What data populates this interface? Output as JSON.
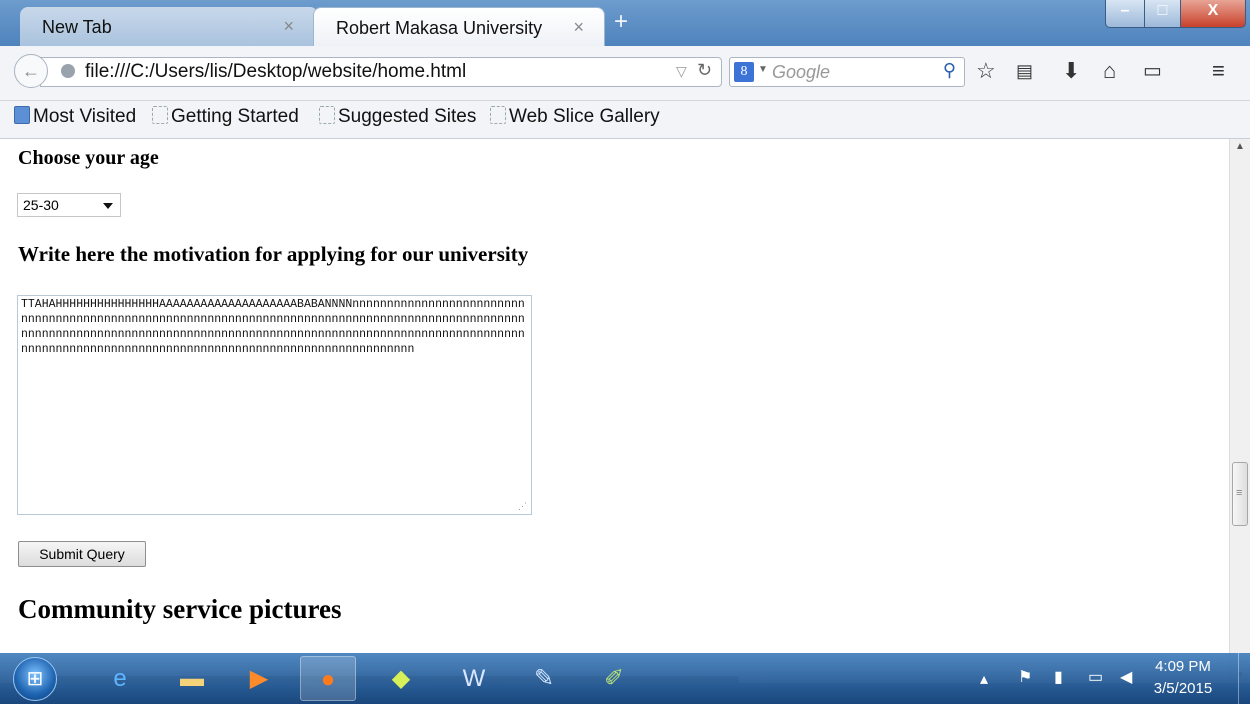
{
  "window": {
    "tabs": [
      {
        "label": "New Tab"
      },
      {
        "label": "Robert Makasa University"
      }
    ],
    "tab_close_glyph": "×",
    "new_tab_glyph": "+",
    "controls": {
      "minimize": "–",
      "maximize": "□",
      "close": "X"
    }
  },
  "navbar": {
    "url": "file:///C:/Users/lis/Desktop/website/home.html",
    "search_engine_badge": "8",
    "search_placeholder": "Google",
    "icons": [
      "back-icon",
      "globe-icon",
      "reload-icon",
      "search-icon",
      "bookmark-star-icon",
      "reading-list-icon",
      "download-icon",
      "home-icon",
      "window-icon",
      "menu-icon"
    ]
  },
  "bookmarks": [
    {
      "label": "Most Visited"
    },
    {
      "label": "Getting Started"
    },
    {
      "label": "Suggested Sites"
    },
    {
      "label": "Web Slice Gallery"
    }
  ],
  "page": {
    "age_heading": "Choose your age",
    "age_selected": "25-30",
    "motivation_heading": "Write here the motivation for applying for our university",
    "motivation_text": "TTAHAHHHHHHHHHHHHHHHAAAAAAAAAAAAAAAAAAAABABANNNNnnnnnnnnnnnnnnnnnnnnnnnnnnnnnnnnnnnnnnnnnnnnnnnnnnnnnnnnnnnnnnnnnnnnnnnnnnnnnnnnnnnnnnnnnnnnnnnnnnnnnnnnnnnnnnnnnnnnnnnnnnnnnnnnnnnnnnnnnnnnnnnnnnnnnnnnnnnnnnnnnnnnnnnnnnnnnnnnnnnnnnnnnnnnnnnnnnnnnnnnnnnnnnnnnnnnnnnnnnnnnnnnnnnn",
    "submit_label": "Submit Query",
    "pictures_heading": "Community service pictures"
  },
  "taskbar": {
    "apps": [
      "start-orb",
      "internet-explorer-icon",
      "file-explorer-icon",
      "media-player-icon",
      "firefox-icon",
      "sticky-notes-icon",
      "word-icon",
      "notepad-icon",
      "paint-icon"
    ],
    "active_app": "firefox-icon",
    "time": "4:09 PM",
    "date": "3/5/2015"
  }
}
